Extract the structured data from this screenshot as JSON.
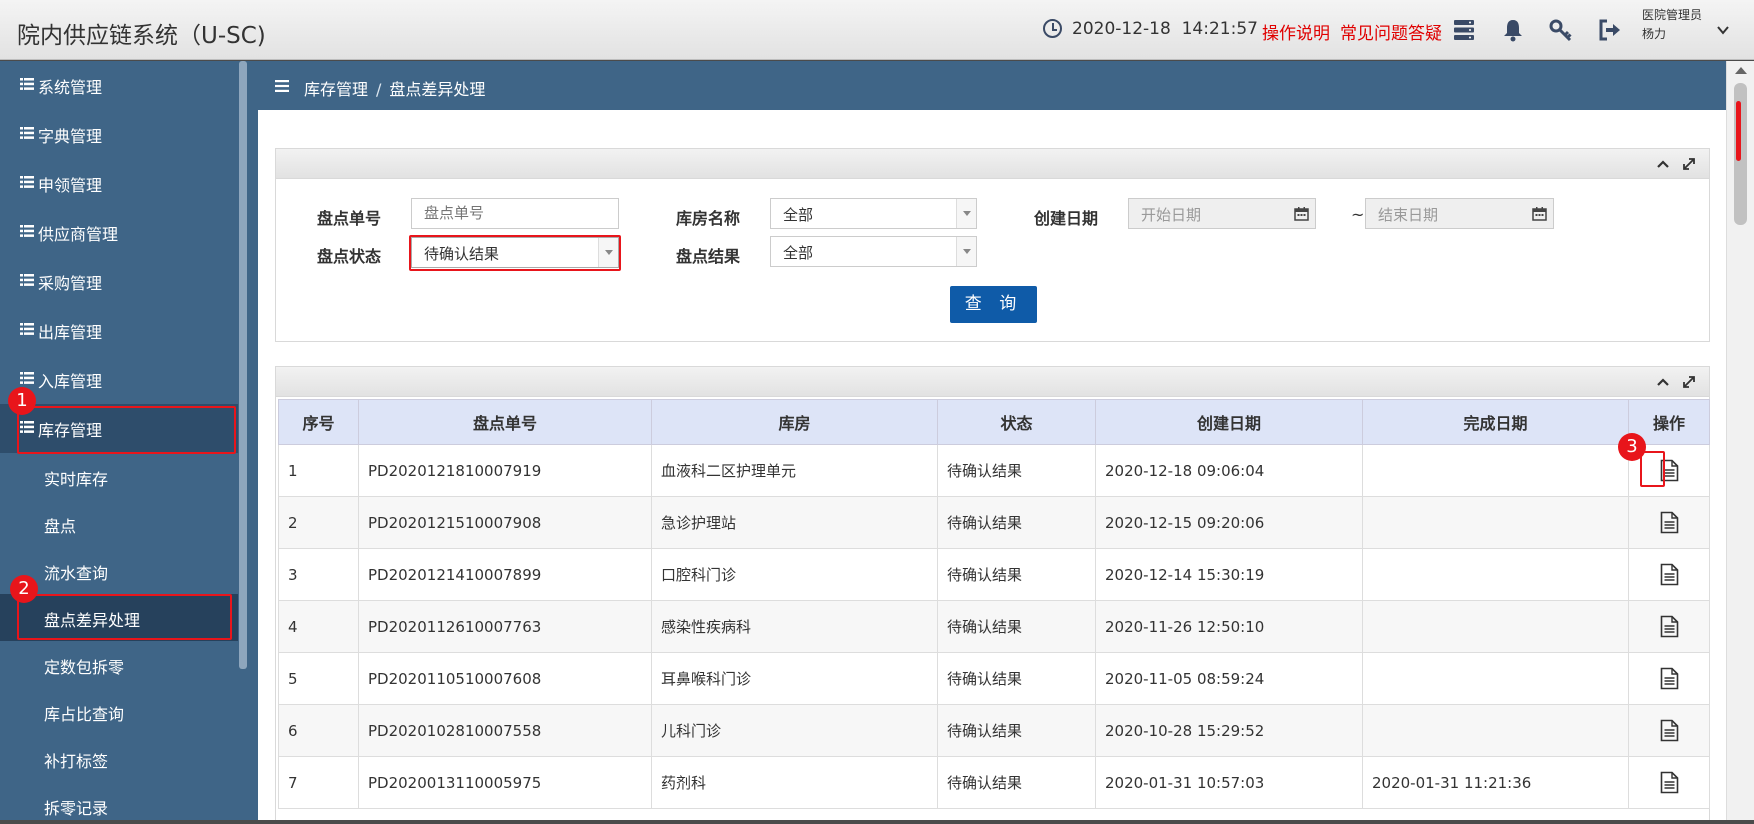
{
  "header": {
    "app_title": "院内供应链系统（U-SC)",
    "datetime": "2020-12-18  14:21:57",
    "help_link": "操作说明",
    "faq_link": "常见问题答疑",
    "user_role": "医院管理员",
    "user_name": "杨力"
  },
  "sidebar": {
    "menu": [
      "系统管理",
      "字典管理",
      "申领管理",
      "供应商管理",
      "采购管理",
      "出库管理",
      "入库管理",
      "库存管理"
    ],
    "submenu": [
      "实时库存",
      "盘点",
      "流水查询",
      "盘点差异处理",
      "定数包拆零",
      "库占比查询",
      "补打标签",
      "拆零记录"
    ]
  },
  "badges": [
    "1",
    "2",
    "3"
  ],
  "breadcrumb": {
    "parent": "库存管理",
    "sep": "/",
    "current": "盘点差异处理"
  },
  "filters": {
    "order_no_label": "盘点单号",
    "order_no_placeholder": "盘点单号",
    "status_label": "盘点状态",
    "status_value": "待确认结果",
    "warehouse_label": "库房名称",
    "warehouse_value": "全部",
    "result_label": "盘点结果",
    "result_value": "全部",
    "date_label": "创建日期",
    "start_placeholder": "开始日期",
    "tilde": "~",
    "end_placeholder": "结束日期",
    "query_button": "查 询"
  },
  "table": {
    "columns": [
      "序号",
      "盘点单号",
      "库房",
      "状态",
      "创建日期",
      "完成日期",
      "操作"
    ],
    "rows": [
      [
        "1",
        "PD2020121810007919",
        "血液科二区护理单元",
        "待确认结果",
        "2020-12-18 09:06:04",
        ""
      ],
      [
        "2",
        "PD2020121510007908",
        "急诊护理站",
        "待确认结果",
        "2020-12-15 09:20:06",
        ""
      ],
      [
        "3",
        "PD2020121410007899",
        "口腔科门诊",
        "待确认结果",
        "2020-12-14 15:30:19",
        ""
      ],
      [
        "4",
        "PD2020112610007763",
        "感染性疾病科",
        "待确认结果",
        "2020-11-26 12:50:10",
        ""
      ],
      [
        "5",
        "PD2020110510007608",
        "耳鼻喉科门诊",
        "待确认结果",
        "2020-11-05 08:59:24",
        ""
      ],
      [
        "6",
        "PD2020102810007558",
        "儿科门诊",
        "待确认结果",
        "2020-10-28 15:29:52",
        ""
      ],
      [
        "7",
        "PD2020013110005975",
        "药剂科",
        "待确认结果",
        "2020-01-31 10:57:03",
        "2020-01-31 11:21:36"
      ]
    ]
  },
  "colors": {
    "sidebar": "#3f6587",
    "accent_red": "#e8151b",
    "query_button": "#0f5ba8",
    "table_header": "#dde4f7"
  }
}
